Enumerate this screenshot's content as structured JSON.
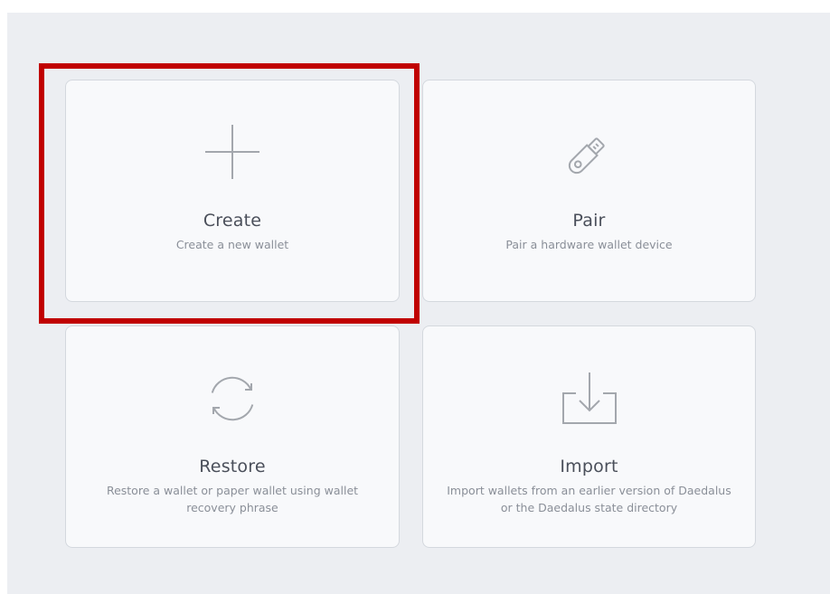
{
  "tiles": {
    "create": {
      "title": "Create",
      "description": "Create a new wallet",
      "icon": "plus-icon"
    },
    "pair": {
      "title": "Pair",
      "description": "Pair a hardware wallet device",
      "icon": "usb-key-icon"
    },
    "restore": {
      "title": "Restore",
      "description": "Restore a wallet or paper wallet using wallet recovery phrase",
      "icon": "refresh-icon"
    },
    "import": {
      "title": "Import",
      "description": "Import wallets from an earlier version of Daedalus or the Daedalus state directory",
      "icon": "download-tray-icon"
    }
  },
  "colors": {
    "background": "#eceef2",
    "tile_background": "#f8f9fb",
    "tile_border": "#d4d8de",
    "icon": "#a3a7ad",
    "title": "#4a4f5a",
    "description": "#8a8f98",
    "highlight": "#c00000"
  }
}
